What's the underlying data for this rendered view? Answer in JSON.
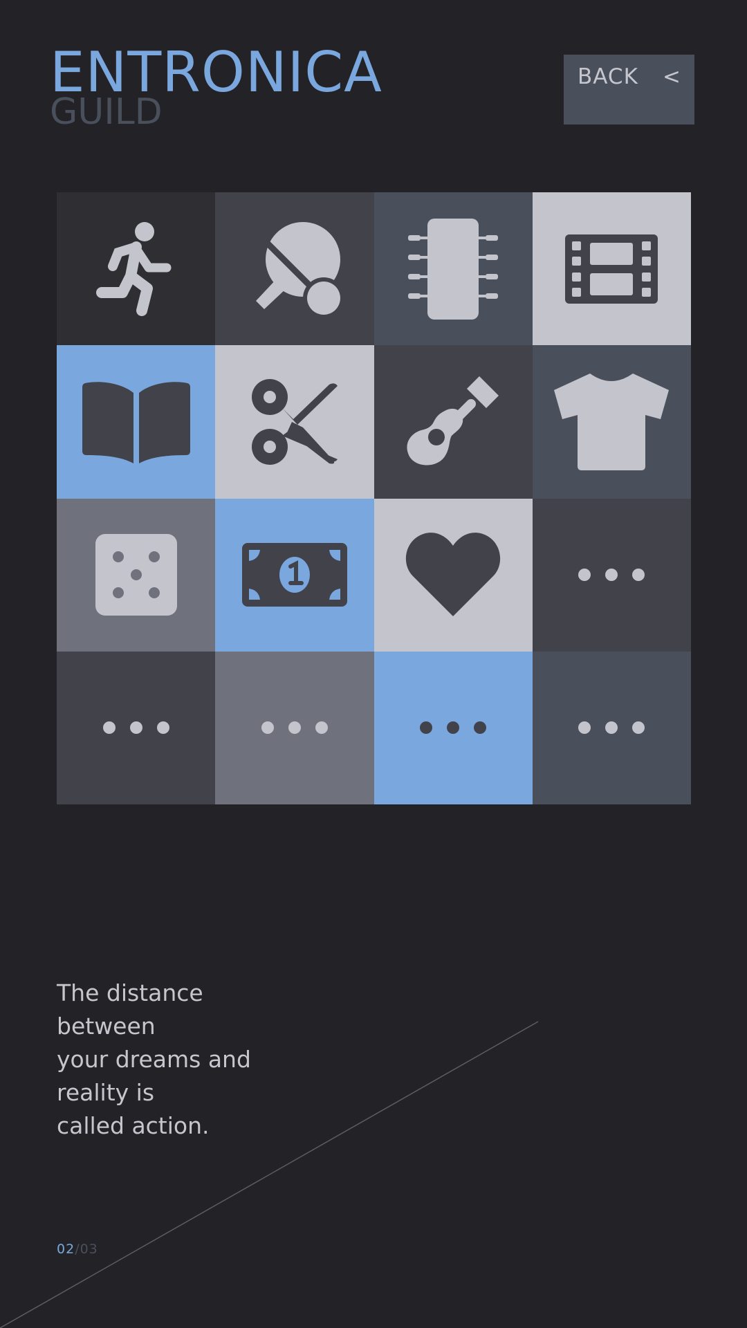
{
  "brand": {
    "title": "ENTRONICA",
    "subtitle": "GUILD"
  },
  "back_button": {
    "label": "BACK",
    "chevron": "<"
  },
  "colors": {
    "background": "#232327",
    "accent": "#7aa7de",
    "light": "#c4c4cc",
    "dark": "#42424b",
    "slate": "#4a505b",
    "gray": "#6f717c",
    "charcoal": "#2e2e33"
  },
  "tiles": [
    {
      "icon": "running-person-icon",
      "bg": "#2e2e33"
    },
    {
      "icon": "ping-pong-icon",
      "bg": "#42424b"
    },
    {
      "icon": "microchip-icon",
      "bg": "#4a505b"
    },
    {
      "icon": "film-icon",
      "bg": "#c4c4cc"
    },
    {
      "icon": "open-book-icon",
      "bg": "#7aa7de"
    },
    {
      "icon": "scissors-icon",
      "bg": "#c4c4cc"
    },
    {
      "icon": "guitar-icon",
      "bg": "#42424b"
    },
    {
      "icon": "t-shirt-icon",
      "bg": "#4a505b"
    },
    {
      "icon": "dice-icon",
      "bg": "#6f717c"
    },
    {
      "icon": "banknote-icon",
      "bg": "#7aa7de"
    },
    {
      "icon": "heart-icon",
      "bg": "#c4c4cc"
    },
    {
      "icon": "more-dots-icon",
      "bg": "#42424b"
    },
    {
      "icon": "more-dots-icon",
      "bg": "#42424b"
    },
    {
      "icon": "more-dots-icon",
      "bg": "#6f717c"
    },
    {
      "icon": "more-dots-icon",
      "bg": "#7aa7de"
    },
    {
      "icon": "more-dots-icon",
      "bg": "#4a505b"
    }
  ],
  "quote": {
    "lines": [
      "The distance",
      "between",
      "your dreams and",
      "reality is",
      "called action."
    ]
  },
  "pager": {
    "current": "02",
    "separator": "/",
    "total": "03"
  }
}
